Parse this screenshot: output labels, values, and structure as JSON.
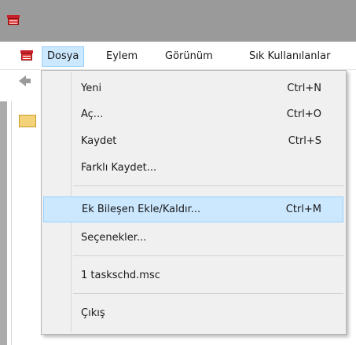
{
  "menubar": {
    "items": [
      {
        "label": "Dosya"
      },
      {
        "label": "Eylem"
      },
      {
        "label": "Görünüm"
      },
      {
        "label": "Sık Kullanılanlar"
      }
    ]
  },
  "dropdown": {
    "items": [
      {
        "label": "Yeni",
        "shortcut": "Ctrl+N"
      },
      {
        "label": "Aç...",
        "shortcut": "Ctrl+O"
      },
      {
        "label": "Kaydet",
        "shortcut": "Ctrl+S"
      },
      {
        "label": "Farklı Kaydet...",
        "shortcut": ""
      },
      {
        "label": "Ek Bileşen Ekle/Kaldır...",
        "shortcut": "Ctrl+M"
      },
      {
        "label": "Seçenekler...",
        "shortcut": ""
      },
      {
        "label": "1 taskschd.msc",
        "shortcut": ""
      },
      {
        "label": "Çıkış",
        "shortcut": ""
      }
    ]
  },
  "icons": {
    "app": "mmc-toolbox-icon",
    "back": "back-arrow-icon",
    "folder": "folder-icon"
  },
  "colors": {
    "highlight_bg": "#cce8ff",
    "highlight_border": "#99d1ff",
    "menu_bg": "#f0f0f0",
    "titlebar_bg": "#9a9a9a"
  }
}
